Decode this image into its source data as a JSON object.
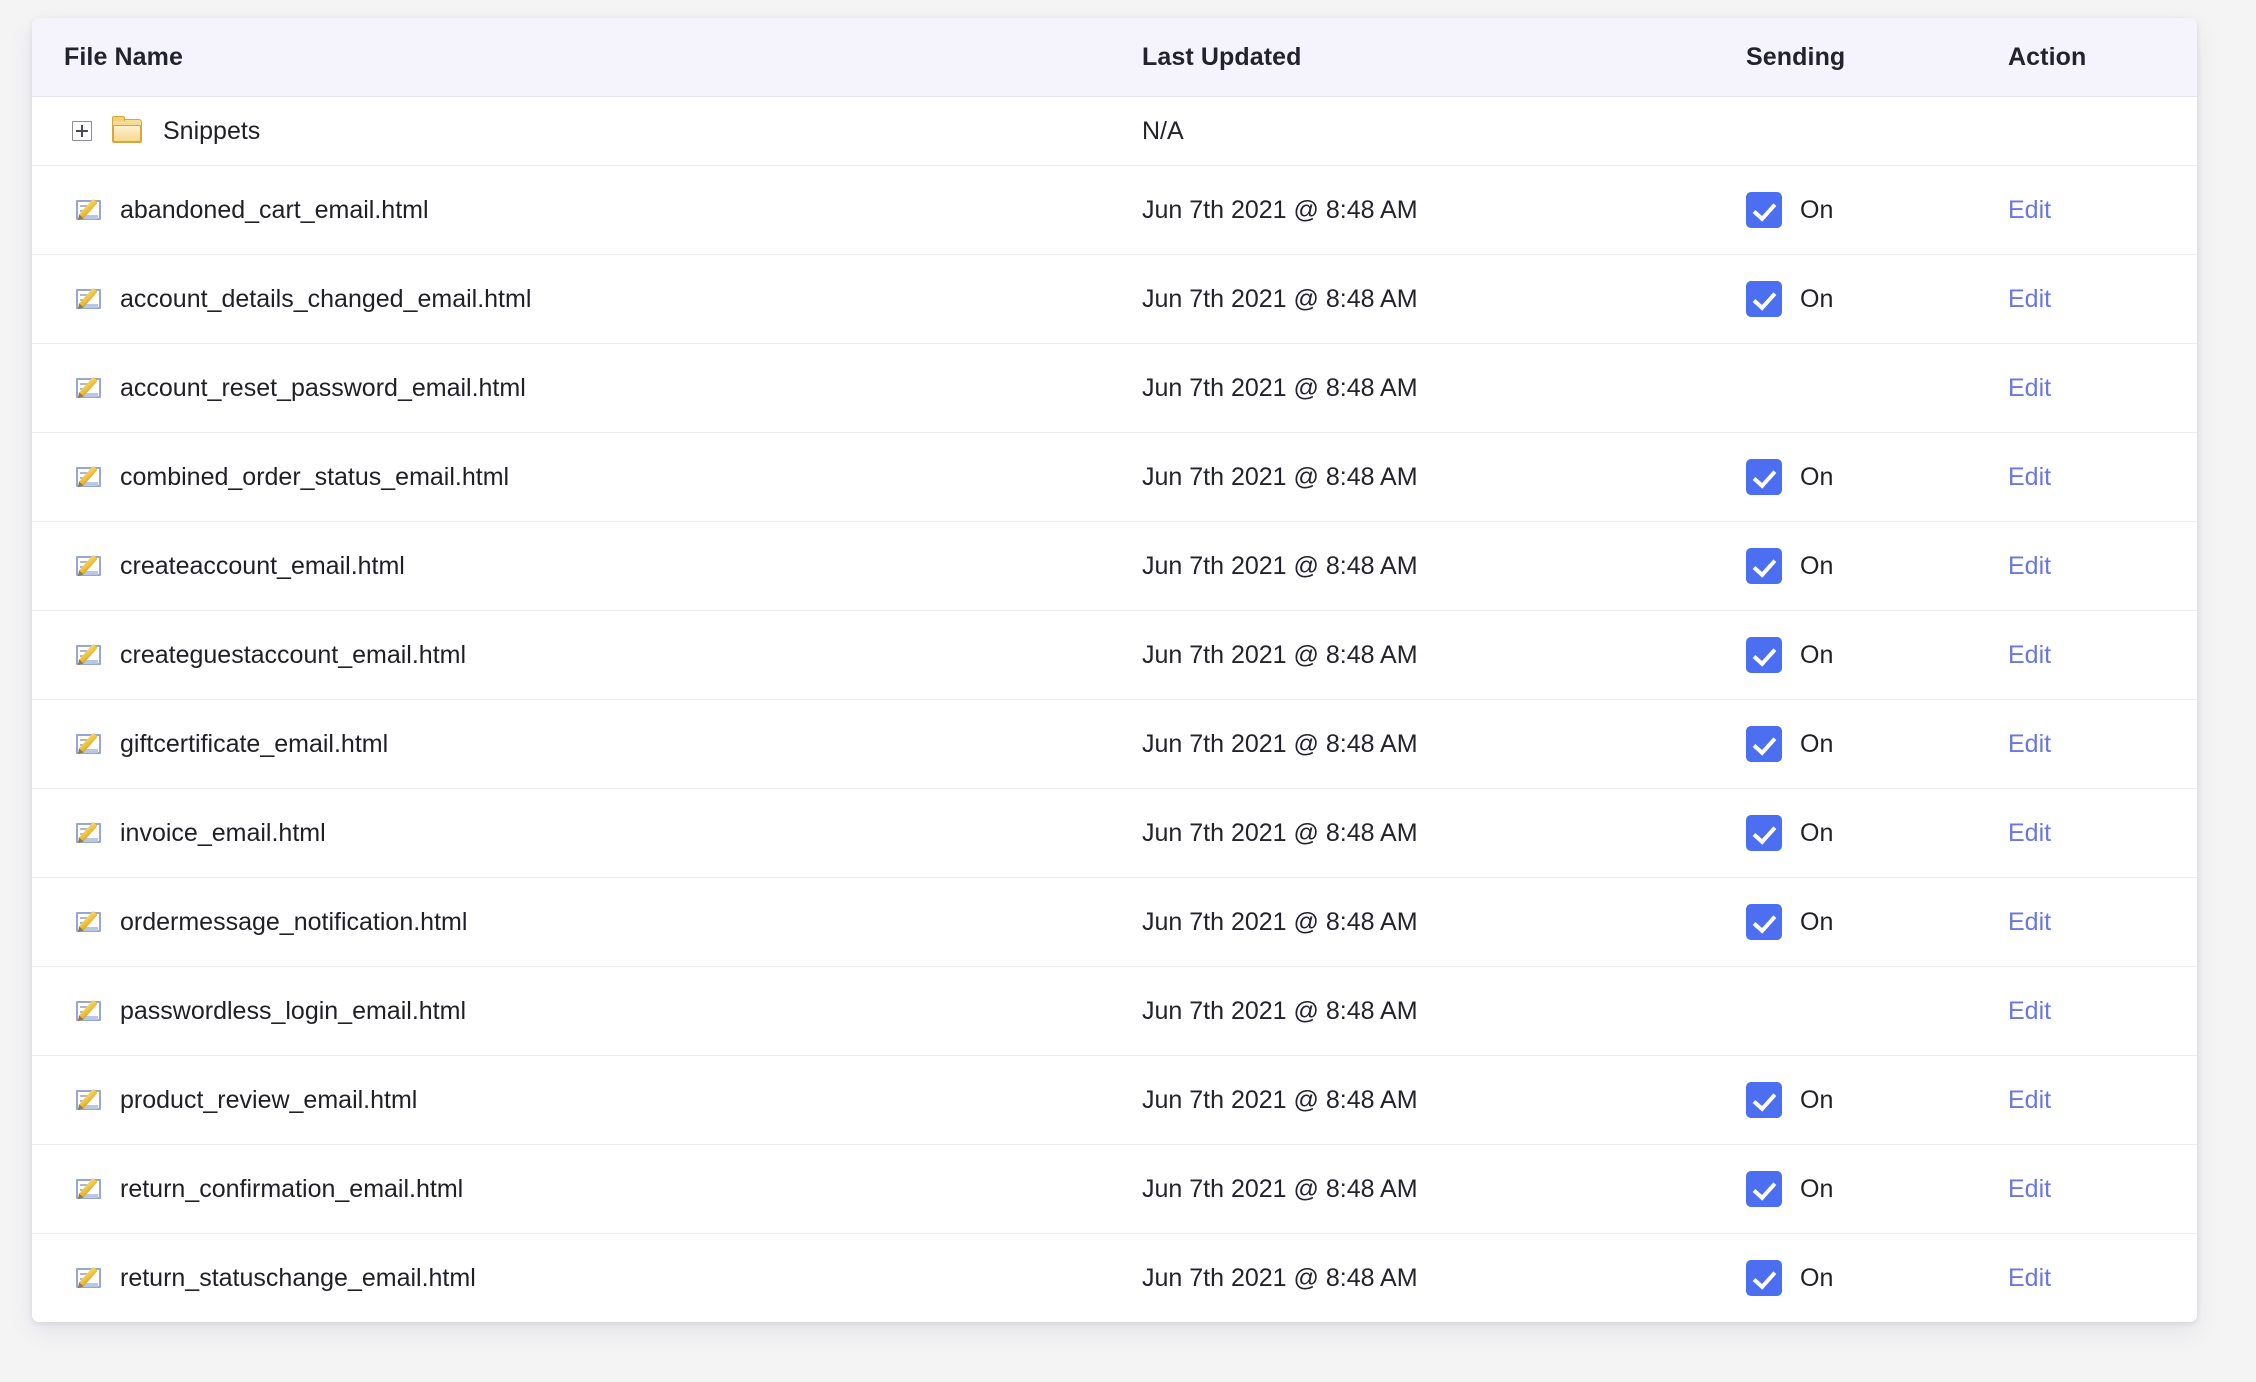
{
  "table": {
    "columns": {
      "file_name": "File Name",
      "last_updated": "Last Updated",
      "sending": "Sending",
      "action": "Action"
    },
    "folder_row": {
      "name": "Snippets",
      "last_updated": "N/A",
      "expander_icon": "plus-square-expander-icon",
      "folder_icon": "folder-icon"
    },
    "edit_label": "Edit",
    "on_label": "On",
    "rows": [
      {
        "name": "abandoned_cart_email.html",
        "last_updated": "Jun 7th 2021 @ 8:48 AM",
        "sending": "On",
        "sending_checked": true,
        "action": "Edit"
      },
      {
        "name": "account_details_changed_email.html",
        "last_updated": "Jun 7th 2021 @ 8:48 AM",
        "sending": "On",
        "sending_checked": true,
        "action": "Edit"
      },
      {
        "name": "account_reset_password_email.html",
        "last_updated": "Jun 7th 2021 @ 8:48 AM",
        "sending": "",
        "sending_checked": false,
        "action": "Edit"
      },
      {
        "name": "combined_order_status_email.html",
        "last_updated": "Jun 7th 2021 @ 8:48 AM",
        "sending": "On",
        "sending_checked": true,
        "action": "Edit"
      },
      {
        "name": "createaccount_email.html",
        "last_updated": "Jun 7th 2021 @ 8:48 AM",
        "sending": "On",
        "sending_checked": true,
        "action": "Edit"
      },
      {
        "name": "createguestaccount_email.html",
        "last_updated": "Jun 7th 2021 @ 8:48 AM",
        "sending": "On",
        "sending_checked": true,
        "action": "Edit"
      },
      {
        "name": "giftcertificate_email.html",
        "last_updated": "Jun 7th 2021 @ 8:48 AM",
        "sending": "On",
        "sending_checked": true,
        "action": "Edit"
      },
      {
        "name": "invoice_email.html",
        "last_updated": "Jun 7th 2021 @ 8:48 AM",
        "sending": "On",
        "sending_checked": true,
        "action": "Edit"
      },
      {
        "name": "ordermessage_notification.html",
        "last_updated": "Jun 7th 2021 @ 8:48 AM",
        "sending": "On",
        "sending_checked": true,
        "action": "Edit"
      },
      {
        "name": "passwordless_login_email.html",
        "last_updated": "Jun 7th 2021 @ 8:48 AM",
        "sending": "",
        "sending_checked": false,
        "action": "Edit"
      },
      {
        "name": "product_review_email.html",
        "last_updated": "Jun 7th 2021 @ 8:48 AM",
        "sending": "On",
        "sending_checked": true,
        "action": "Edit"
      },
      {
        "name": "return_confirmation_email.html",
        "last_updated": "Jun 7th 2021 @ 8:48 AM",
        "sending": "On",
        "sending_checked": true,
        "action": "Edit"
      },
      {
        "name": "return_statuschange_email.html",
        "last_updated": "Jun 7th 2021 @ 8:48 AM",
        "sending": "On",
        "sending_checked": true,
        "action": "Edit"
      }
    ]
  },
  "colors": {
    "page_background": "#f4f4f5",
    "card_background": "#ffffff",
    "header_background": "#f5f4fd",
    "checkbox_blue": "#4c6ef0",
    "edit_link": "#6a77e0",
    "row_divider": "#ededf0",
    "text": "#1f1f26"
  }
}
